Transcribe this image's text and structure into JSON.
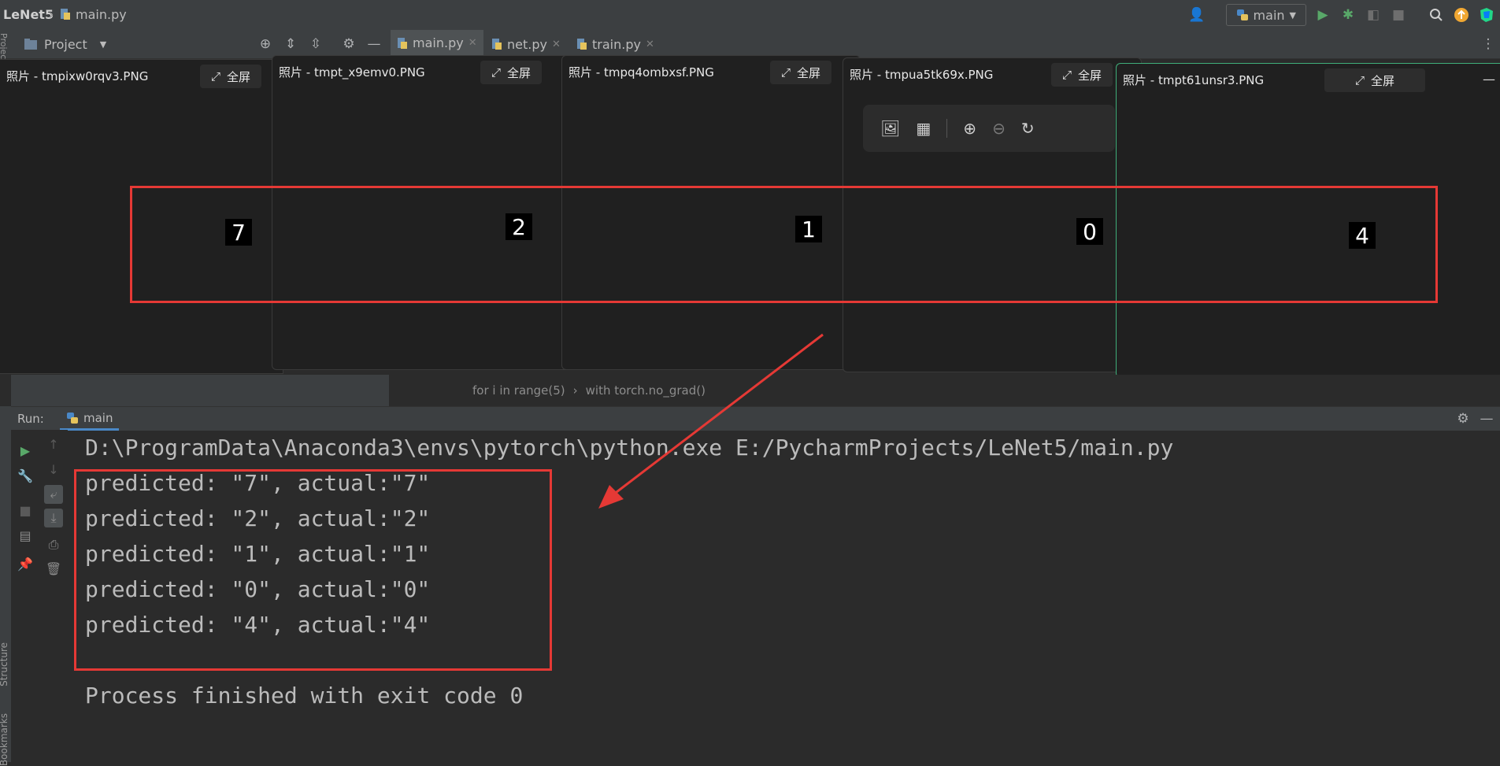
{
  "titlebar": {
    "project": "LeNet5",
    "file": "main.py",
    "run_config": "main"
  },
  "tool_header": {
    "project_label": "Project",
    "side_label": "Project"
  },
  "editor_tabs": [
    {
      "label": "main.py",
      "active": true
    },
    {
      "label": "net.py",
      "active": false
    },
    {
      "label": "train.py",
      "active": false
    }
  ],
  "photos": [
    {
      "title": "照片 - tmpixw0rqv3.PNG",
      "fullscreen": "全屏",
      "digit": "7"
    },
    {
      "title": "照片 - tmpt_x9emv0.PNG",
      "fullscreen": "全屏",
      "digit": "2"
    },
    {
      "title": "照片 - tmpq4ombxsf.PNG",
      "fullscreen": "全屏",
      "digit": "1"
    },
    {
      "title": "照片 - tmpua5tk69x.PNG",
      "fullscreen": "全屏",
      "digit": "0"
    },
    {
      "title": "照片 - tmpt61unsr3.PNG",
      "fullscreen": "全屏",
      "digit": "4"
    }
  ],
  "breadcrumb": [
    "for i in range(5)",
    "with torch.no_grad()"
  ],
  "run": {
    "label": "Run:",
    "tab": "main",
    "side_structure": "Structure",
    "side_bookmarks": "Bookmarks"
  },
  "console": {
    "command": "D:\\ProgramData\\Anaconda3\\envs\\pytorch\\python.exe E:/PycharmProjects/LeNet5/main.py",
    "lines": [
      "predicted: \"7\", actual:\"7\"",
      "predicted: \"2\", actual:\"2\"",
      "predicted: \"1\", actual:\"1\"",
      "predicted: \"0\", actual:\"0\"",
      "predicted: \"4\", actual:\"4\""
    ],
    "exit": "Process finished with exit code 0"
  },
  "colors": {
    "accent": "#4a88c7",
    "annotation_red": "#e53935",
    "run_green": "#59a869",
    "active_window_border": "#3fae7a"
  }
}
